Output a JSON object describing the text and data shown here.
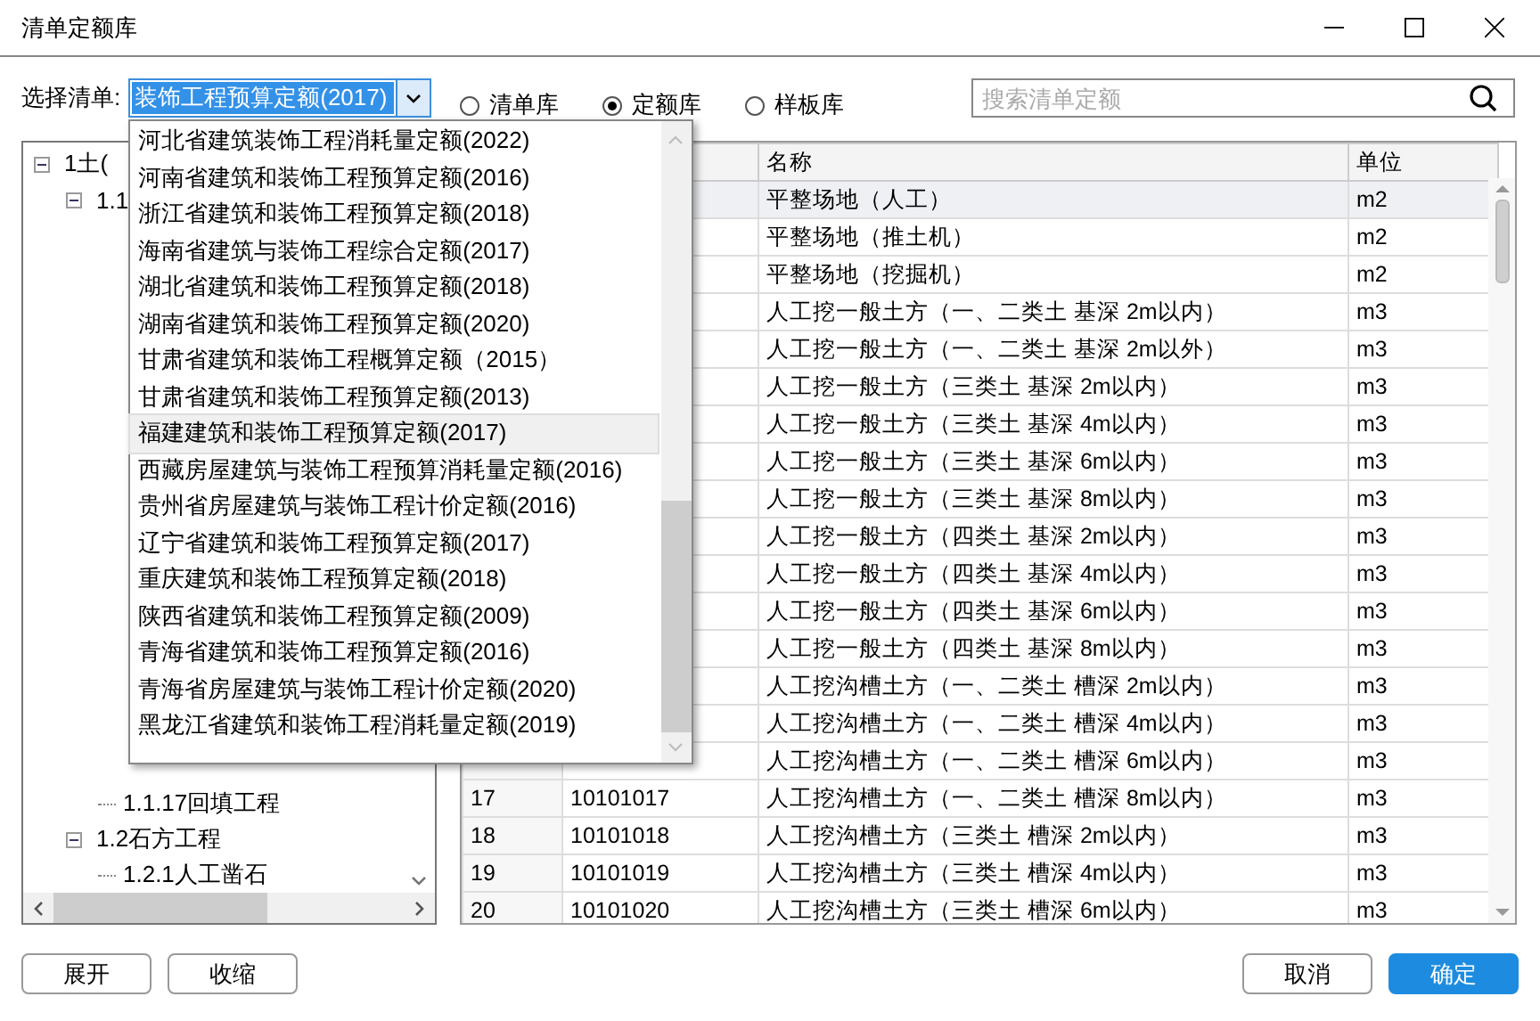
{
  "window": {
    "title": "清单定额库"
  },
  "selector": {
    "label": "选择清单:",
    "value": "装饰工程预算定额(2017)",
    "open": true
  },
  "library_options": [
    {
      "label": "清单库",
      "selected": false
    },
    {
      "label": "定额库",
      "selected": true
    },
    {
      "label": "样板库",
      "selected": false
    }
  ],
  "search": {
    "placeholder": "搜索清单定额"
  },
  "dropdown_items": [
    {
      "label": "河北省建筑装饰工程消耗量定额(2022)",
      "selected": false
    },
    {
      "label": "河南省建筑和装饰工程预算定额(2016)",
      "selected": false
    },
    {
      "label": "浙江省建筑和装饰工程预算定额(2018)",
      "selected": false
    },
    {
      "label": "海南省建筑与装饰工程综合定额(2017)",
      "selected": false
    },
    {
      "label": "湖北省建筑和装饰工程预算定额(2018)",
      "selected": false
    },
    {
      "label": "湖南省建筑和装饰工程预算定额(2020)",
      "selected": false
    },
    {
      "label": "甘肃省建筑和装饰工程概算定额（2015）",
      "selected": false
    },
    {
      "label": "甘肃省建筑和装饰工程预算定额(2013)",
      "selected": false
    },
    {
      "label": "福建建筑和装饰工程预算定额(2017)",
      "selected": true
    },
    {
      "label": "西藏房屋建筑与装饰工程预算消耗量定额(2016)",
      "selected": false
    },
    {
      "label": "贵州省房屋建筑与装饰工程计价定额(2016)",
      "selected": false
    },
    {
      "label": "辽宁省建筑和装饰工程预算定额(2017)",
      "selected": false
    },
    {
      "label": "重庆建筑和装饰工程预算定额(2018)",
      "selected": false
    },
    {
      "label": "陕西省建筑和装饰工程预算定额(2009)",
      "selected": false
    },
    {
      "label": "青海省建筑和装饰工程预算定额(2016)",
      "selected": false
    },
    {
      "label": "青海省房屋建筑与装饰工程计价定额(2020)",
      "selected": false
    },
    {
      "label": "黑龙江省建筑和装饰工程消耗量定额(2019)",
      "selected": false
    }
  ],
  "tree": [
    {
      "label": "1土(",
      "expanded": true,
      "children": [
        {
          "label": "1.1",
          "expanded": true,
          "children": [
            {
              "label": "1.1.17回填工程"
            }
          ]
        },
        {
          "label": "1.2石方工程",
          "expanded": true,
          "children": [
            {
              "label": "1.2.1人工凿石"
            }
          ]
        }
      ]
    }
  ],
  "table": {
    "columns": [
      "名称",
      "单位"
    ],
    "rows": [
      {
        "name": "平整场地（人工）",
        "unit": "m2",
        "selected": true
      },
      {
        "name": "平整场地（推土机）",
        "unit": "m2",
        "selected": false
      },
      {
        "name": "平整场地（挖掘机）",
        "unit": "m2",
        "selected": false
      },
      {
        "name": "人工挖一般土方（一、二类土 基深 2m以内）",
        "unit": "m3",
        "selected": false
      },
      {
        "name": "人工挖一般土方（一、二类土 基深 2m以外）",
        "unit": "m3",
        "selected": false
      },
      {
        "name": "人工挖一般土方（三类土 基深 2m以内）",
        "unit": "m3",
        "selected": false
      },
      {
        "name": "人工挖一般土方（三类土 基深 4m以内）",
        "unit": "m3",
        "selected": false
      },
      {
        "name": "人工挖一般土方（三类土 基深 6m以内）",
        "unit": "m3",
        "selected": false
      },
      {
        "name": "人工挖一般土方（三类土 基深 8m以内）",
        "unit": "m3",
        "selected": false
      },
      {
        "name": "人工挖一般土方（四类土 基深 2m以内）",
        "unit": "m3",
        "selected": false
      },
      {
        "name": "人工挖一般土方（四类土 基深 4m以内）",
        "unit": "m3",
        "selected": false
      },
      {
        "name": "人工挖一般土方（四类土 基深 6m以内）",
        "unit": "m3",
        "selected": false
      },
      {
        "name": "人工挖一般土方（四类土 基深 8m以内）",
        "unit": "m3",
        "selected": false
      },
      {
        "name": "人工挖沟槽土方（一、二类土 槽深 2m以内）",
        "unit": "m3",
        "selected": false
      },
      {
        "name": "人工挖沟槽土方（一、二类土 槽深 4m以内）",
        "unit": "m3",
        "selected": false
      },
      {
        "name": "人工挖沟槽土方（一、二类土 槽深 6m以内）",
        "unit": "m3",
        "selected": false
      },
      {
        "index": "17",
        "code": "10101017",
        "name": "人工挖沟槽土方（一、二类土 槽深 8m以内）",
        "unit": "m3",
        "selected": false
      },
      {
        "index": "18",
        "code": "10101018",
        "name": "人工挖沟槽土方（三类土 槽深 2m以内）",
        "unit": "m3",
        "selected": false
      },
      {
        "index": "19",
        "code": "10101019",
        "name": "人工挖沟槽土方（三类土 槽深 4m以内）",
        "unit": "m3",
        "selected": false
      },
      {
        "index": "20",
        "code": "10101020",
        "name": "人工挖沟槽土方（三类土 槽深 6m以内）",
        "unit": "m3",
        "selected": false
      }
    ]
  },
  "buttons_left": [
    "展开",
    "收缩"
  ],
  "buttons_right": [
    {
      "label": "取消",
      "kind": "secondary"
    },
    {
      "label": "确定",
      "kind": "primary"
    }
  ]
}
